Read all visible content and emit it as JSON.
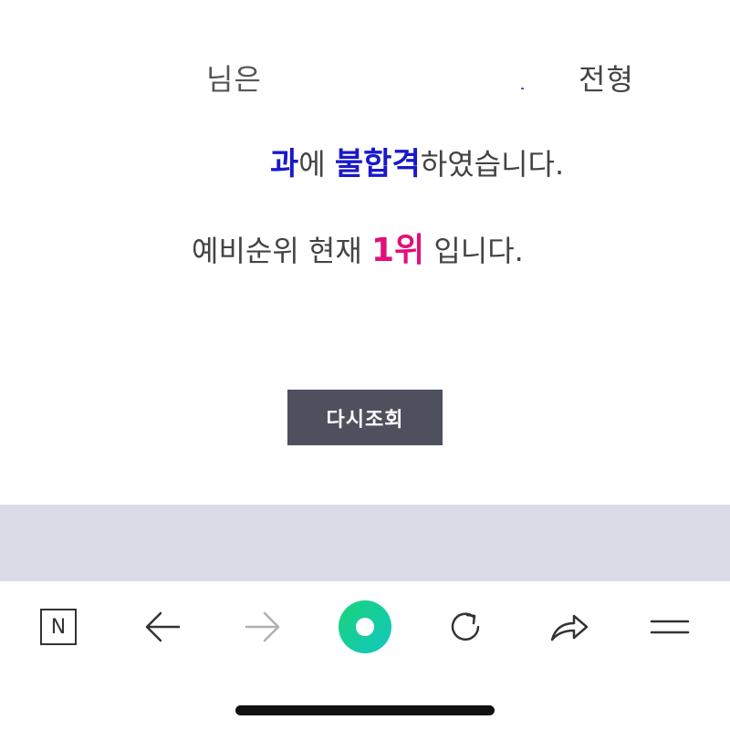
{
  "result": {
    "line1_left_fragment": "님은",
    "line1_right_fragment": "전형",
    "line2_word_dept_suffix": "과",
    "line2_particle": "에 ",
    "line2_status": "불합격",
    "line2_tail": "하였습니다.",
    "line3_prefix": "예비순위 현재 ",
    "line3_rank": "1위",
    "line3_tail": " 입니다."
  },
  "retry_button": {
    "label": "다시조회"
  },
  "browser_toolbar": {
    "home_label": "N",
    "icons": [
      "naver-home-icon",
      "back-arrow-icon",
      "forward-arrow-icon",
      "green-dot-menu-icon",
      "reload-icon",
      "share-icon",
      "hamburger-menu-icon"
    ]
  },
  "colors": {
    "emphasis_blue": "#1a18c9",
    "emphasis_pink": "#e0107a",
    "button_bg": "#4f505e",
    "band_gray": "#d9dce6",
    "green_gradient_start": "#19d47a",
    "green_gradient_end": "#13c7c0"
  }
}
